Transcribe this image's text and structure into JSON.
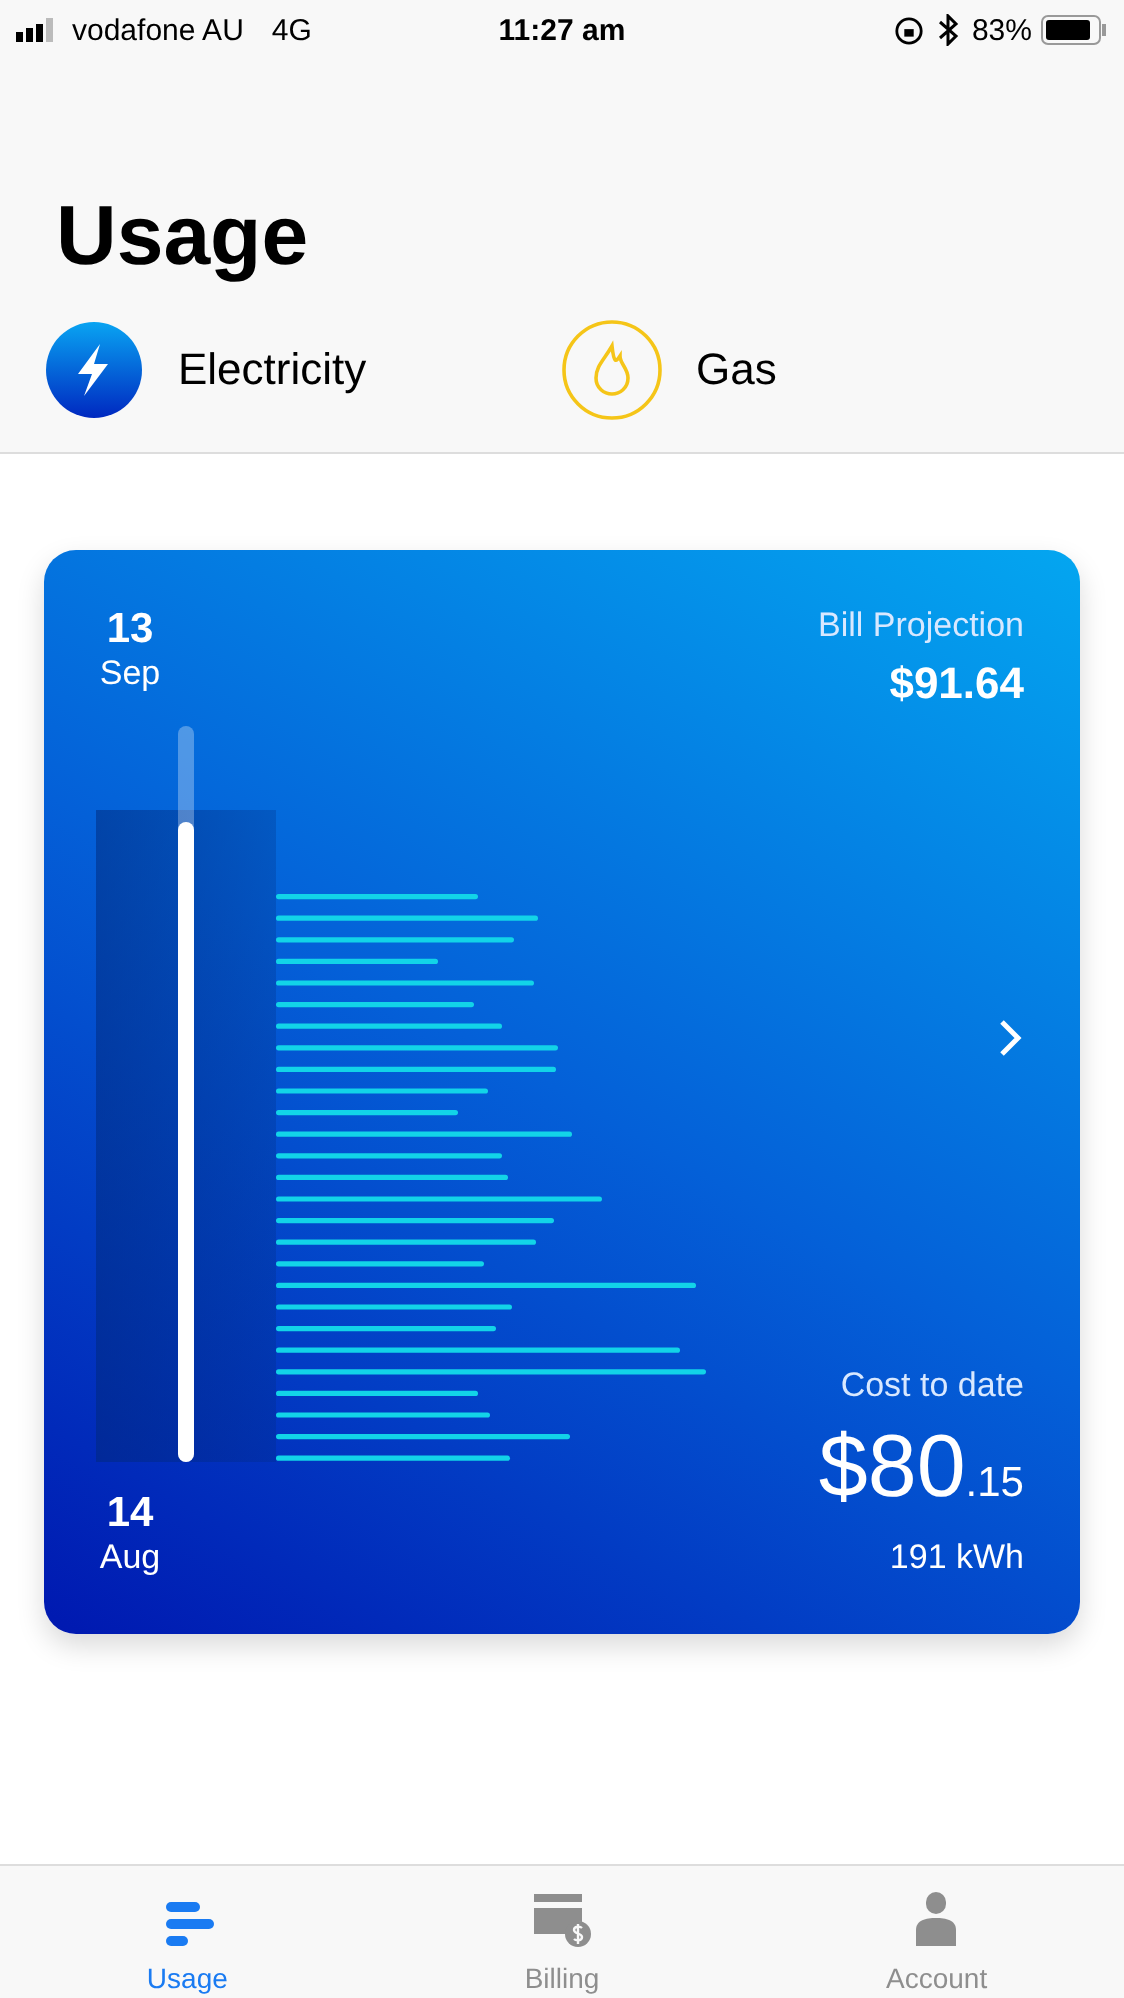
{
  "status_bar": {
    "carrier": "vodafone AU",
    "network": "4G",
    "time": "11:27 am",
    "battery": "83%"
  },
  "title": "Usage",
  "fuel_tabs": [
    {
      "kind": "electricity",
      "label": "Electricity",
      "selected": true
    },
    {
      "kind": "gas",
      "label": "Gas",
      "selected": false
    }
  ],
  "card": {
    "end_day": "13",
    "end_month": "Sep",
    "start_day": "14",
    "start_month": "Aug",
    "projection_label": "Bill Projection",
    "projection": "$91.64",
    "cost_label": "Cost to date",
    "cost_main": "$80",
    "cost_cents": ".15",
    "energy": "191 kWh",
    "period": {
      "level": 0.87
    }
  },
  "nav": [
    {
      "kind": "usage",
      "label": "Usage",
      "selected": true
    },
    {
      "kind": "billing",
      "label": "Billing",
      "selected": false
    },
    {
      "kind": "account",
      "label": "Account",
      "selected": false
    }
  ]
}
